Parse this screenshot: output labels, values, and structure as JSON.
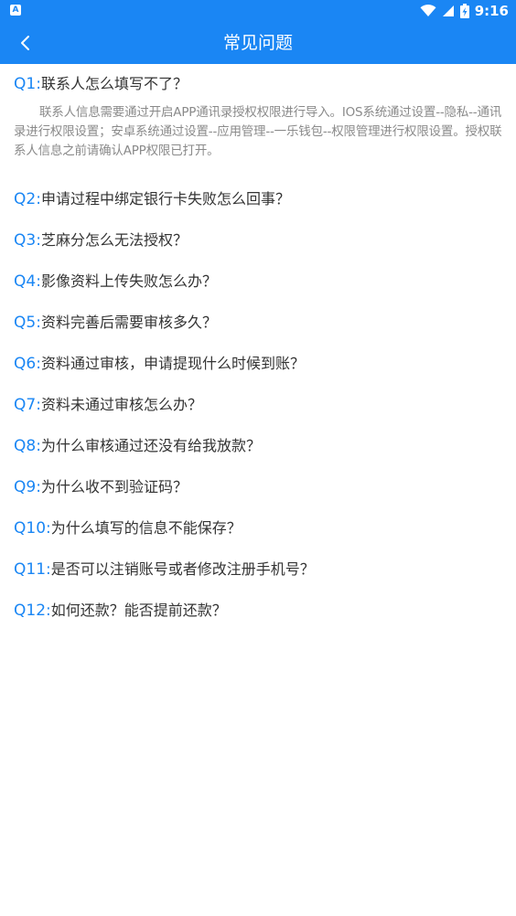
{
  "status_bar": {
    "app_badge": "A",
    "time": "9:16",
    "icons": [
      "wifi-icon",
      "signal-icon",
      "battery-charging-icon"
    ]
  },
  "app_bar": {
    "back_icon": "chevron-left-icon",
    "title": "常见问题"
  },
  "faq": [
    {
      "num": "Q1:",
      "text": "联系人怎么填写不了？",
      "answer": "联系人信息需要通过开启APP通讯录授权权限进行导入。IOS系统通过设置--隐私--通讯录进行权限设置；安卓系统通过设置--应用管理--一乐钱包--权限管理进行权限设置。授权联系人信息之前请确认APP权限已打开。"
    },
    {
      "num": "Q2:",
      "text": "申请过程中绑定银行卡失败怎么回事？"
    },
    {
      "num": "Q3:",
      "text": "芝麻分怎么无法授权？"
    },
    {
      "num": "Q4:",
      "text": "影像资料上传失败怎么办？"
    },
    {
      "num": "Q5:",
      "text": "资料完善后需要审核多久？"
    },
    {
      "num": "Q6:",
      "text": "资料通过审核，申请提现什么时候到账？"
    },
    {
      "num": "Q7:",
      "text": "资料未通过审核怎么办？"
    },
    {
      "num": "Q8:",
      "text": "为什么审核通过还没有给我放款？"
    },
    {
      "num": "Q9:",
      "text": "为什么收不到验证码？"
    },
    {
      "num": "Q10:",
      "text": "为什么填写的信息不能保存？"
    },
    {
      "num": "Q11:",
      "text": "是否可以注销账号或者修改注册手机号？"
    },
    {
      "num": "Q12:",
      "text": "如何还款？能否提前还款？"
    }
  ],
  "colors": {
    "primary": "#1a86f4",
    "question_text": "#333333",
    "answer_text": "#8a8a8a"
  }
}
